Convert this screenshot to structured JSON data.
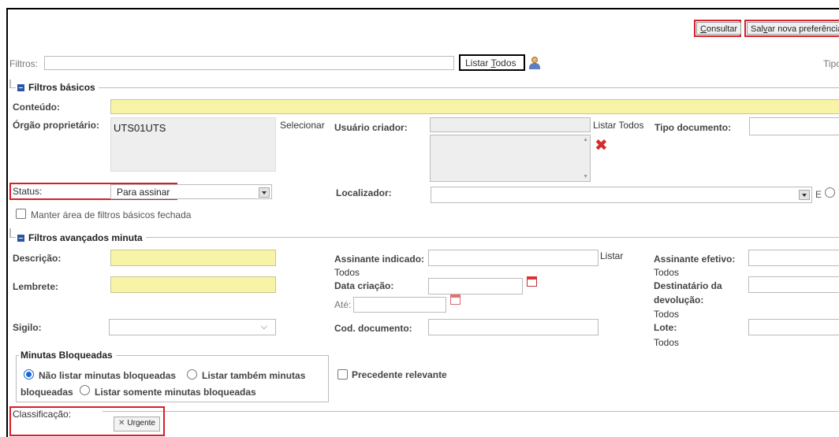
{
  "toolbar": {
    "consult_label": "Consultar",
    "save_pref_label": "Salvar nova preferência"
  },
  "filters": {
    "label": "Filtros:",
    "list_all": "Listar Todos",
    "tipo": "Tipo"
  },
  "basic": {
    "legend": "Filtros básicos",
    "conteudo": "Conteúdo:",
    "orgao": "Órgão proprietário:",
    "orgao_value": "UTS01UTS",
    "selecionar": "Selecionar",
    "usuario": "Usuário criador:",
    "listar_todos": "Listar Todos",
    "tipo_doc": "Tipo documento:",
    "status": "Status:",
    "status_value": "Para assinar",
    "localizador": "Localizador:",
    "e_label": "E",
    "manter": "Manter área de filtros básicos fechada"
  },
  "advanced": {
    "legend": "Filtros avançados minuta",
    "descricao": "Descrição:",
    "assinante_ind": "Assinante indicado:",
    "listar": "Listar",
    "todos": "Todos",
    "assinante_ef": "Assinante efetivo:",
    "todos2": "Todos",
    "lembrete": "Lembrete:",
    "data_criacao": "Data criação:",
    "destinatario": "Destinatário da",
    "devolucao": "devolução:",
    "todos3": "Todos",
    "ate": "Até:",
    "sigilo": "Sigilo:",
    "cod_doc": "Cod. documento:",
    "lote": "Lote:",
    "todos4": "Todos"
  },
  "blocked": {
    "legend": "Minutas Bloqueadas",
    "opt1": "Não listar minutas bloqueadas",
    "opt2a": "Listar também minutas",
    "opt2b": "bloqueadas",
    "opt3": "Listar somente minutas bloqueadas"
  },
  "precedente": "Precedente relevante",
  "classificacao": {
    "label": "Classificação:",
    "tag": "Urgente"
  }
}
